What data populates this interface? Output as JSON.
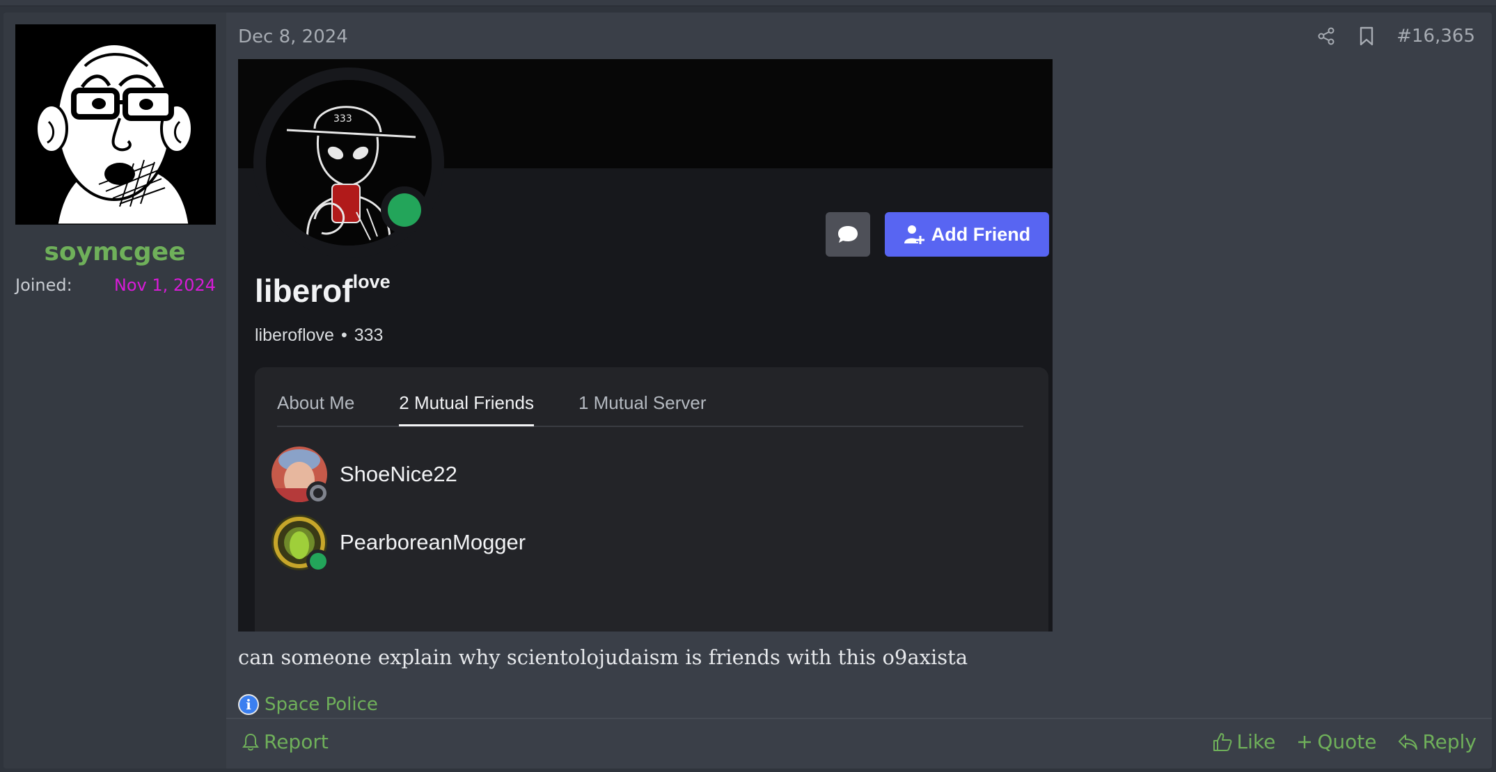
{
  "post": {
    "author": {
      "username": "soymcgee",
      "joined_label": "Joined:",
      "joined_value": "Nov 1, 2024"
    },
    "date": "Dec 8, 2024",
    "post_number": "#16,365",
    "body_text": "can someone explain why scientolojudaism is friends with this o9axista",
    "signature": "Space Police",
    "actions": {
      "report": "Report",
      "like": "Like",
      "quote": "Quote",
      "reply": "Reply"
    }
  },
  "embedded_profile": {
    "pfp_text": "333",
    "display_name_main": "liberof",
    "display_name_sup": "love",
    "handle": "liberoflove",
    "separator": "•",
    "tag": "333",
    "add_friend_label": "Add Friend",
    "tabs": [
      "About Me",
      "2 Mutual Friends",
      "1 Mutual Server"
    ],
    "active_tab": "2 Mutual Friends",
    "mutual_friends": [
      {
        "name": "ShoeNice22",
        "status": "offline"
      },
      {
        "name": "PearboreanMogger",
        "status": "online"
      }
    ]
  },
  "colors": {
    "accent_green": "#6fb05a",
    "joined_magenta": "#d81bd8",
    "discord_blurple": "#5865f2",
    "online_green": "#23a55a",
    "offline_gray": "#80848e"
  },
  "icons": {
    "share": "share-icon",
    "bookmark": "bookmark-icon",
    "bell": "bell-icon",
    "like": "thumbs-up-icon",
    "quote": "plus-icon",
    "reply": "reply-icon",
    "info": "info-icon",
    "chat": "chat-bubble-icon",
    "add_friend": "add-friend-icon"
  }
}
